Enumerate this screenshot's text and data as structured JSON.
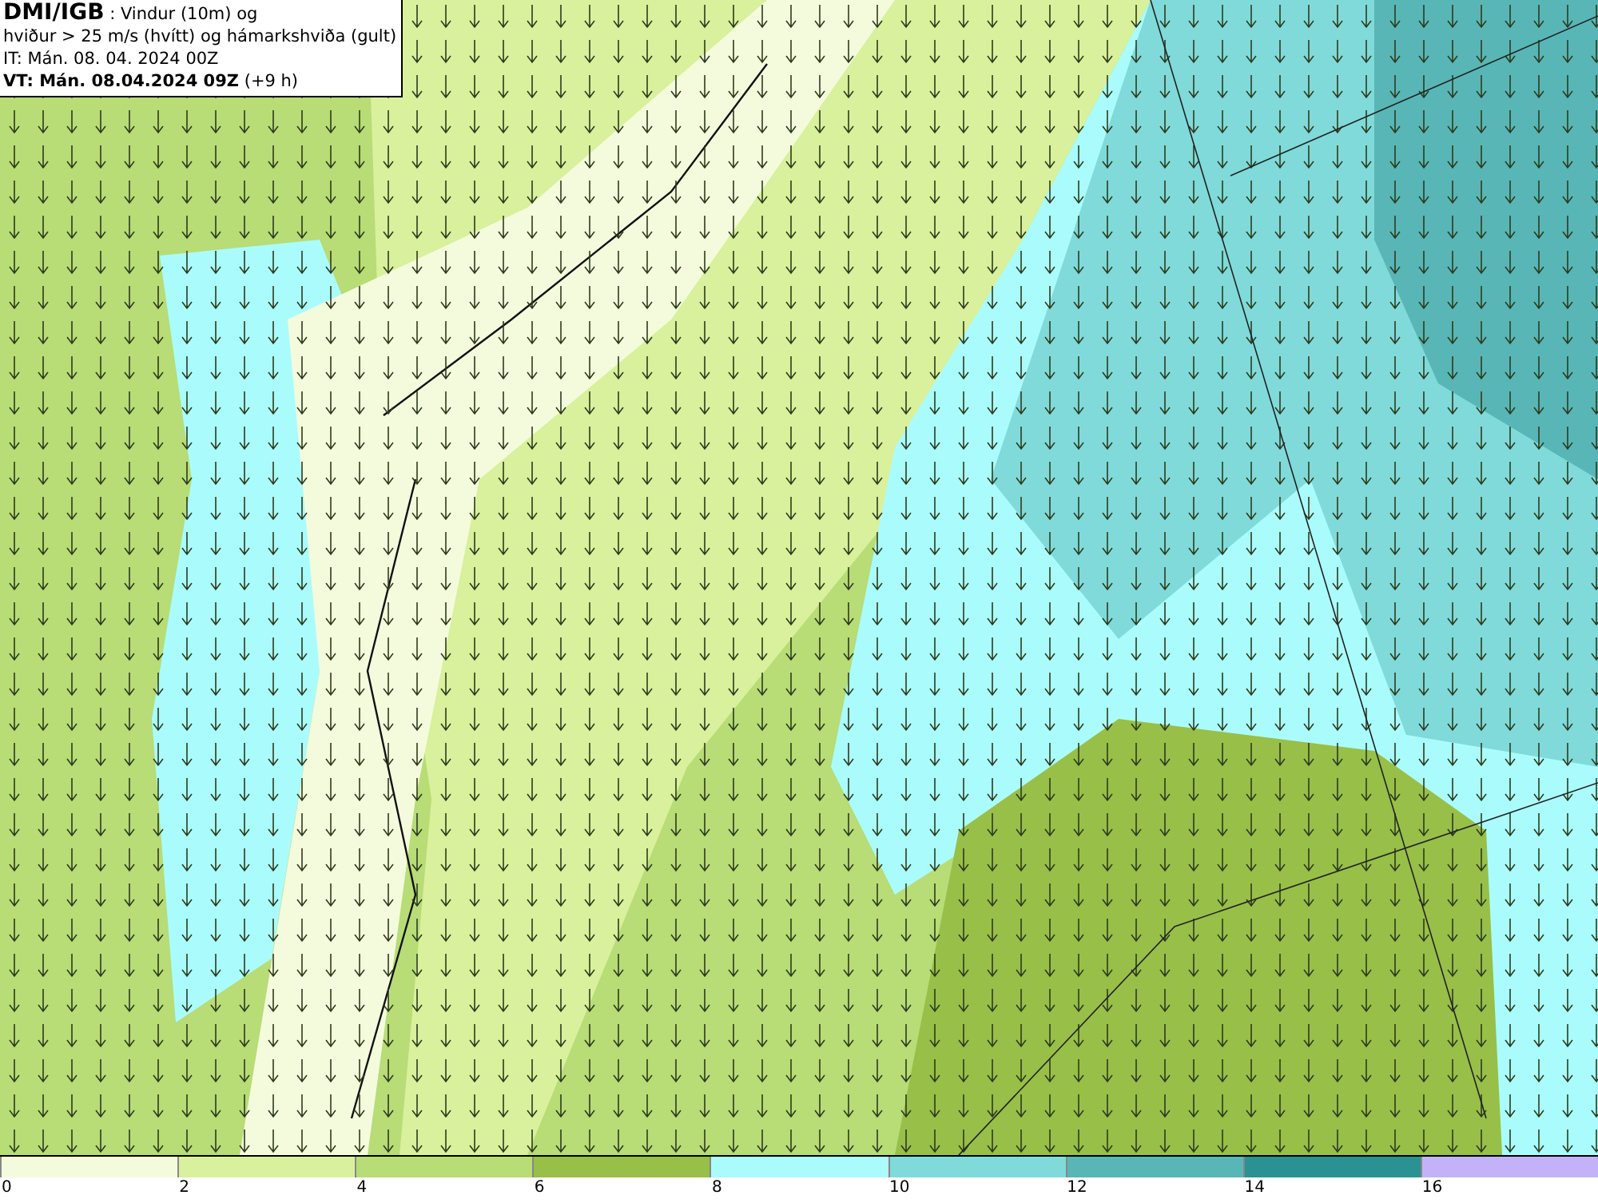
{
  "info_box": {
    "lines": [
      "**DMI/IGB** : Vindur (10m) og",
      "hviður > 25 m/s (hvítt) og hámarkshviða (gult)",
      "IT: Mán. 08. 04. 2024 00Z",
      "**VT: Mán. 08.04.2024 09Z** (+9 h)"
    ]
  },
  "legend": [
    {
      "label": "0",
      "color": "#f4fbdc"
    },
    {
      "label": "2",
      "color": "#d9f09c"
    },
    {
      "label": "4",
      "color": "#b8dc76"
    },
    {
      "label": "6",
      "color": "#98bf48"
    },
    {
      "label": "8",
      "color": "#aafcfc"
    },
    {
      "label": "10",
      "color": "#80dada"
    },
    {
      "label": "12",
      "color": "#58b6b6"
    },
    {
      "label": "14",
      "color": "#2a9292"
    },
    {
      "label": "16",
      "color": "#c4b2f8"
    }
  ]
}
